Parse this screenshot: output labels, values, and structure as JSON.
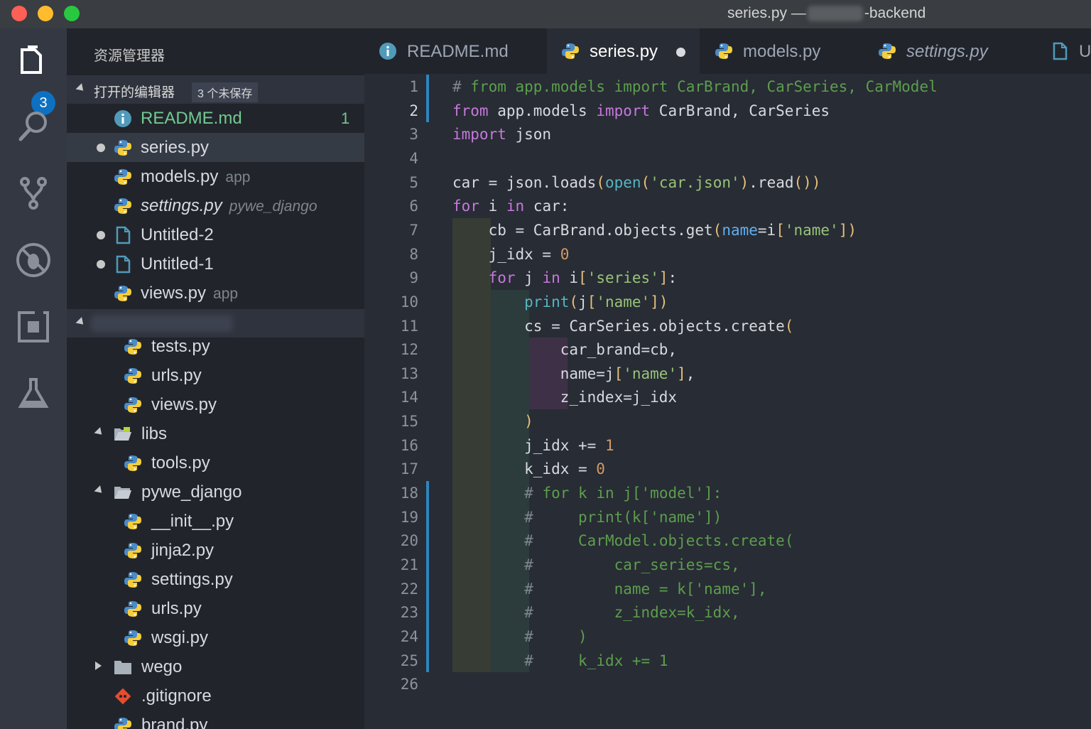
{
  "window": {
    "title_prefix": "series.py —",
    "title_suffix": "-backend",
    "lights": {
      "close": "#fe5f57",
      "minimize": "#febc2e",
      "maximize": "#28c840"
    }
  },
  "activity_bar": {
    "items": [
      "explorer-icon",
      "search-icon",
      "source-control-icon",
      "debug-icon",
      "extensions-icon",
      "test-flask-icon"
    ],
    "explorer_badge": "3"
  },
  "sidebar": {
    "title": "资源管理器",
    "open_editors": {
      "label": "打开的编辑器",
      "unsaved": "3 个未保存",
      "items": [
        {
          "name": "README.md",
          "desc": "",
          "count": "1",
          "icon": "info-icon",
          "dirty": false,
          "selected": false
        },
        {
          "name": "series.py",
          "desc": "",
          "count": "",
          "icon": "python-icon",
          "dirty": true,
          "selected": true
        },
        {
          "name": "models.py",
          "desc": "app",
          "count": "",
          "icon": "python-icon",
          "dirty": false,
          "selected": false
        },
        {
          "name": "settings.py",
          "desc": "pywe_django",
          "count": "",
          "icon": "python-icon",
          "dirty": false,
          "selected": false
        },
        {
          "name": "Untitled-2",
          "desc": "",
          "count": "",
          "icon": "file-icon",
          "dirty": true,
          "selected": false
        },
        {
          "name": "Untitled-1",
          "desc": "",
          "count": "",
          "icon": "file-icon",
          "dirty": true,
          "selected": false
        },
        {
          "name": "views.py",
          "desc": "app",
          "count": "",
          "icon": "python-icon",
          "dirty": false,
          "selected": false
        }
      ]
    },
    "tree": [
      {
        "name": "tests.py",
        "type": "python"
      },
      {
        "name": "urls.py",
        "type": "python"
      },
      {
        "name": "views.py",
        "type": "python"
      },
      {
        "name": "libs",
        "type": "folder-open"
      },
      {
        "name": "tools.py",
        "type": "python"
      },
      {
        "name": "pywe_django",
        "type": "folder-open"
      },
      {
        "name": "__init__.py",
        "type": "python"
      },
      {
        "name": "jinja2.py",
        "type": "python"
      },
      {
        "name": "settings.py",
        "type": "python"
      },
      {
        "name": "urls.py",
        "type": "python"
      },
      {
        "name": "wsgi.py",
        "type": "python"
      },
      {
        "name": "wego",
        "type": "folder-closed"
      },
      {
        "name": ".gitignore",
        "type": "git"
      },
      {
        "name": "brand.py",
        "type": "python"
      }
    ]
  },
  "tabs": [
    {
      "label": "README.md",
      "icon": "info-icon",
      "active": false,
      "italic": false
    },
    {
      "label": "series.py",
      "icon": "python-icon",
      "active": true,
      "italic": false,
      "modified": true
    },
    {
      "label": "models.py",
      "icon": "python-icon",
      "active": false,
      "italic": false
    },
    {
      "label": "settings.py",
      "icon": "python-icon",
      "active": false,
      "italic": true
    },
    {
      "label": "U",
      "icon": "file-icon",
      "active": false,
      "italic": false
    }
  ],
  "editor": {
    "current_line": 2,
    "lines": [
      "# from app.models import CarBrand, CarSeries, CarModel",
      "from app.models import CarBrand, CarSeries",
      "import json",
      "",
      "car = json.loads(open('car.json').read())",
      "for i in car:",
      "    cb = CarBrand.objects.get(name=i['name'])",
      "    j_idx = 0",
      "    for j in i['series']:",
      "        print(j['name'])",
      "        cs = CarSeries.objects.create(",
      "            car_brand=cb,",
      "            name=j['name'],",
      "            z_index=j_idx",
      "        )",
      "        j_idx += 1",
      "        k_idx = 0",
      "        # for k in j['model']:",
      "        #     print(k['name'])",
      "        #     CarModel.objects.create(",
      "        #         car_series=cs,",
      "        #         name = k['name'],",
      "        #         z_index=k_idx,",
      "        #     )",
      "        #     k_idx += 1",
      ""
    ]
  }
}
